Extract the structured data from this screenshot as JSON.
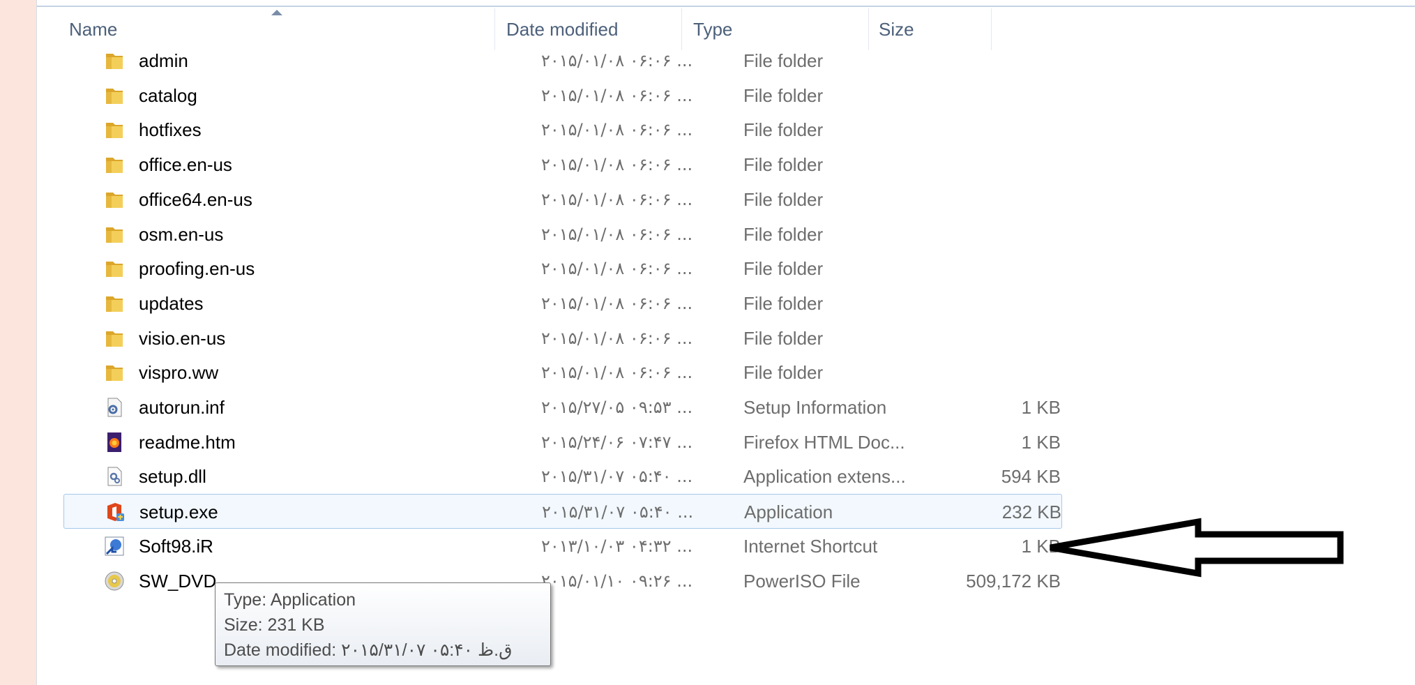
{
  "columns": {
    "name": "Name",
    "date_modified": "Date modified",
    "type": "Type",
    "size": "Size"
  },
  "files": [
    {
      "name": "admin",
      "date": "۲۰۱۵/۰۱/۰۸ ۰۶:۰۶ ...",
      "type": "File folder",
      "size": "",
      "icon": "folder-icon"
    },
    {
      "name": "catalog",
      "date": "۲۰۱۵/۰۱/۰۸ ۰۶:۰۶ ...",
      "type": "File folder",
      "size": "",
      "icon": "folder-icon"
    },
    {
      "name": "hotfixes",
      "date": "۲۰۱۵/۰۱/۰۸ ۰۶:۰۶ ...",
      "type": "File folder",
      "size": "",
      "icon": "folder-icon"
    },
    {
      "name": "office.en-us",
      "date": "۲۰۱۵/۰۱/۰۸ ۰۶:۰۶ ...",
      "type": "File folder",
      "size": "",
      "icon": "folder-icon"
    },
    {
      "name": "office64.en-us",
      "date": "۲۰۱۵/۰۱/۰۸ ۰۶:۰۶ ...",
      "type": "File folder",
      "size": "",
      "icon": "folder-icon"
    },
    {
      "name": "osm.en-us",
      "date": "۲۰۱۵/۰۱/۰۸ ۰۶:۰۶ ...",
      "type": "File folder",
      "size": "",
      "icon": "folder-icon"
    },
    {
      "name": "proofing.en-us",
      "date": "۲۰۱۵/۰۱/۰۸ ۰۶:۰۶ ...",
      "type": "File folder",
      "size": "",
      "icon": "folder-icon"
    },
    {
      "name": "updates",
      "date": "۲۰۱۵/۰۱/۰۸ ۰۶:۰۶ ...",
      "type": "File folder",
      "size": "",
      "icon": "folder-icon"
    },
    {
      "name": "visio.en-us",
      "date": "۲۰۱۵/۰۱/۰۸ ۰۶:۰۶ ...",
      "type": "File folder",
      "size": "",
      "icon": "folder-icon"
    },
    {
      "name": "vispro.ww",
      "date": "۲۰۱۵/۰۱/۰۸ ۰۶:۰۶ ...",
      "type": "File folder",
      "size": "",
      "icon": "folder-icon"
    },
    {
      "name": "autorun.inf",
      "date": "۲۰۱۵/۲۷/۰۵ ۰۹:۵۳ ...",
      "type": "Setup Information",
      "size": "1 KB",
      "icon": "settings-file-icon"
    },
    {
      "name": "readme.htm",
      "date": "۲۰۱۵/۲۴/۰۶ ۰۷:۴۷ ...",
      "type": "Firefox HTML Doc...",
      "size": "1 KB",
      "icon": "firefox-document-icon"
    },
    {
      "name": "setup.dll",
      "date": "۲۰۱۵/۳۱/۰۷ ۰۵:۴۰ ...",
      "type": "Application extens...",
      "size": "594 KB",
      "icon": "dll-file-icon"
    },
    {
      "name": "setup.exe",
      "date": "۲۰۱۵/۳۱/۰۷ ۰۵:۴۰ ...",
      "type": "Application",
      "size": "232 KB",
      "icon": "office-setup-icon",
      "selected": true
    },
    {
      "name": "Soft98.iR",
      "date": "۲۰۱۳/۱۰/۰۳ ۰۴:۳۲ ...",
      "type": "Internet Shortcut",
      "size": "1 KB",
      "icon": "internet-shortcut-icon"
    },
    {
      "name": "SW_DVD",
      "date": "۲۰۱۵/۰۱/۱۰ ۰۹:۲۶ ...",
      "type": "PowerISO File",
      "size": "509,172 KB",
      "icon": "disc-image-icon"
    }
  ],
  "tooltip": {
    "type_line": "Type: Application",
    "size_line": "Size: 231 KB",
    "date_line": "Date modified: ۲۰۱۵/۳۱/۰۷ ق.ظ ۰۵:۴۰"
  },
  "colors": {
    "selection_fill": "#f2f8fe",
    "selection_border": "#a6c8ec",
    "folder": "#e8b830",
    "header_text": "#4c607a"
  },
  "annotation_icon": "arrow-left-icon"
}
